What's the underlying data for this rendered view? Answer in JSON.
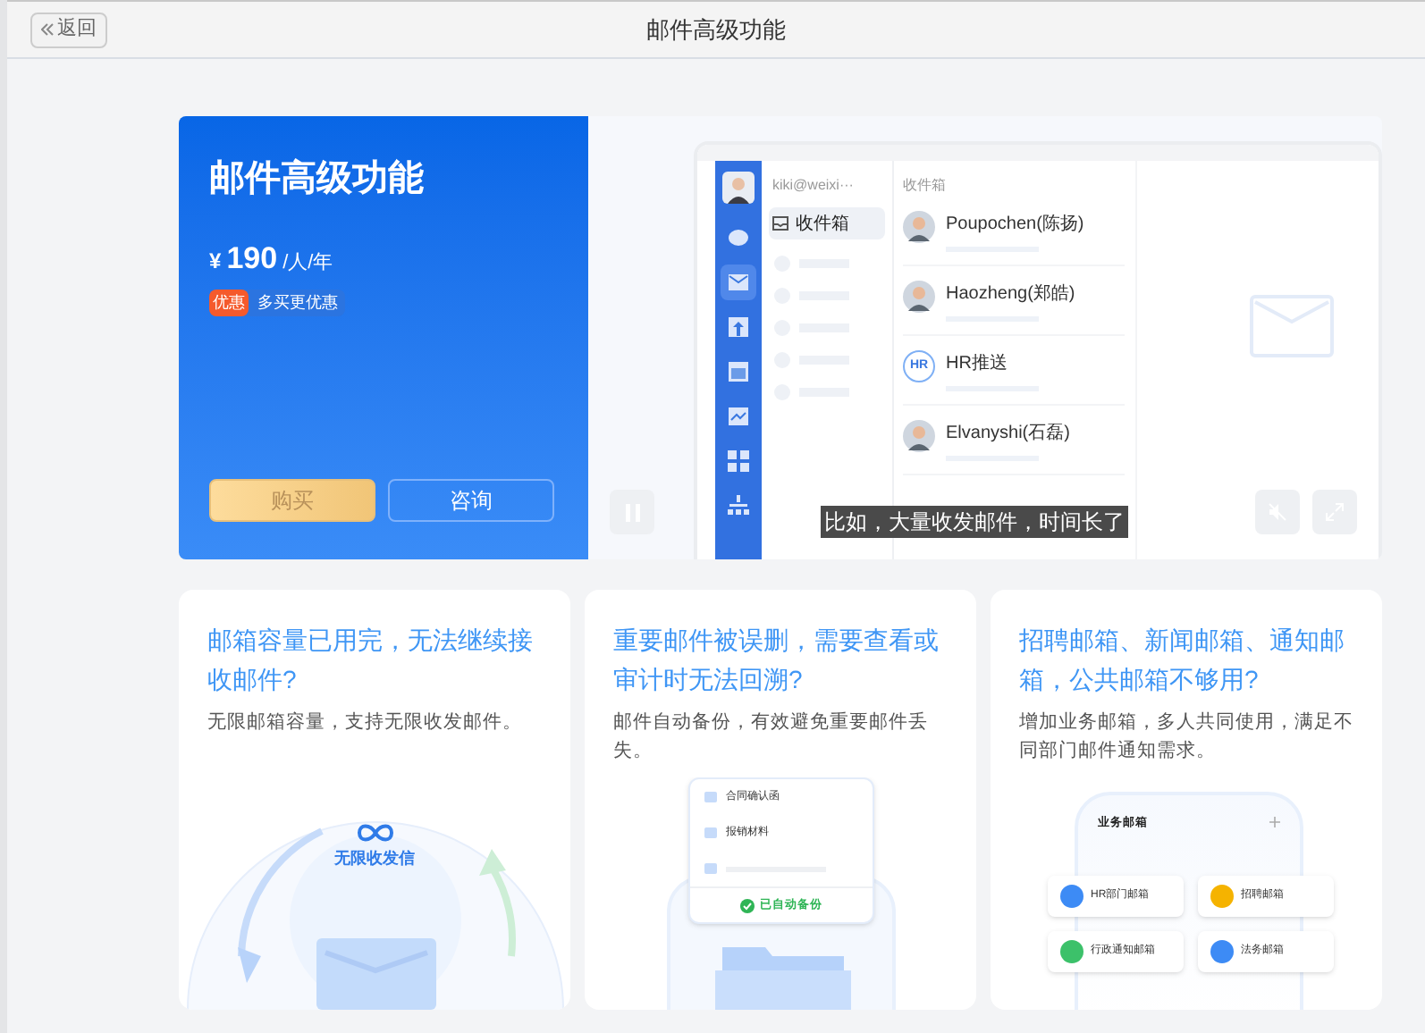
{
  "header": {
    "back_button": "返回",
    "title": "邮件高级功能"
  },
  "hero": {
    "title": "邮件高级功能",
    "currency": "¥",
    "price": "190",
    "unit": "/人/年",
    "promo_badge": "优惠",
    "promo_text": "多买更优惠",
    "buttons": [
      {
        "label": "购买",
        "kind": "primary"
      },
      {
        "label": "咨询",
        "kind": "outline"
      }
    ]
  },
  "video": {
    "nav_items": [
      {
        "selected": false
      },
      {
        "selected": true
      },
      {
        "selected": false
      },
      {
        "selected": false
      },
      {
        "selected": false
      },
      {
        "selected": false
      },
      {
        "selected": false
      }
    ],
    "account": "kiki@weixi···",
    "folders": [
      {
        "label": "收件箱",
        "selected": true
      }
    ],
    "list_title": "收件箱",
    "messages": [
      {
        "sender": "Poupochen(陈扬)",
        "kind": "photo"
      },
      {
        "sender": "Haozheng(郑皓)",
        "kind": "photo"
      },
      {
        "sender": "HR推送",
        "kind": "initials",
        "initials": "HR"
      },
      {
        "sender": "Elvanyshi(石磊)",
        "kind": "photo"
      }
    ],
    "subtitle": "比如，大量收发邮件，时间长了"
  },
  "cards": [
    {
      "kind": "unlimited",
      "title": "邮箱容量已用完，无法继续接收邮件?",
      "text": "无限邮箱容量，支持无限收发邮件。",
      "caption": "无限收发信"
    },
    {
      "kind": "backup",
      "title": "重要邮件被误删，需要查看或审计时无法回溯?",
      "text": "邮件自动备份，有效避免重要邮件丢失。",
      "items": [
        "合同确认函",
        "报销材料"
      ],
      "status": "已自动备份"
    },
    {
      "kind": "shared",
      "title": "招聘邮箱、新闻邮箱、通知邮箱，公共邮箱不够用?",
      "text": "增加业务邮箱，多人共同使用，满足不同部门邮件通知需求。",
      "panel_title": "业务邮箱",
      "mailboxes": [
        {
          "label": "HR部门邮箱",
          "color": "#3d8bf5"
        },
        {
          "label": "招聘邮箱",
          "color": "#f5b300"
        },
        {
          "label": "行政通知邮箱",
          "color": "#3cc16a"
        },
        {
          "label": "法务邮箱",
          "color": "#3d8bf5"
        }
      ]
    }
  ]
}
